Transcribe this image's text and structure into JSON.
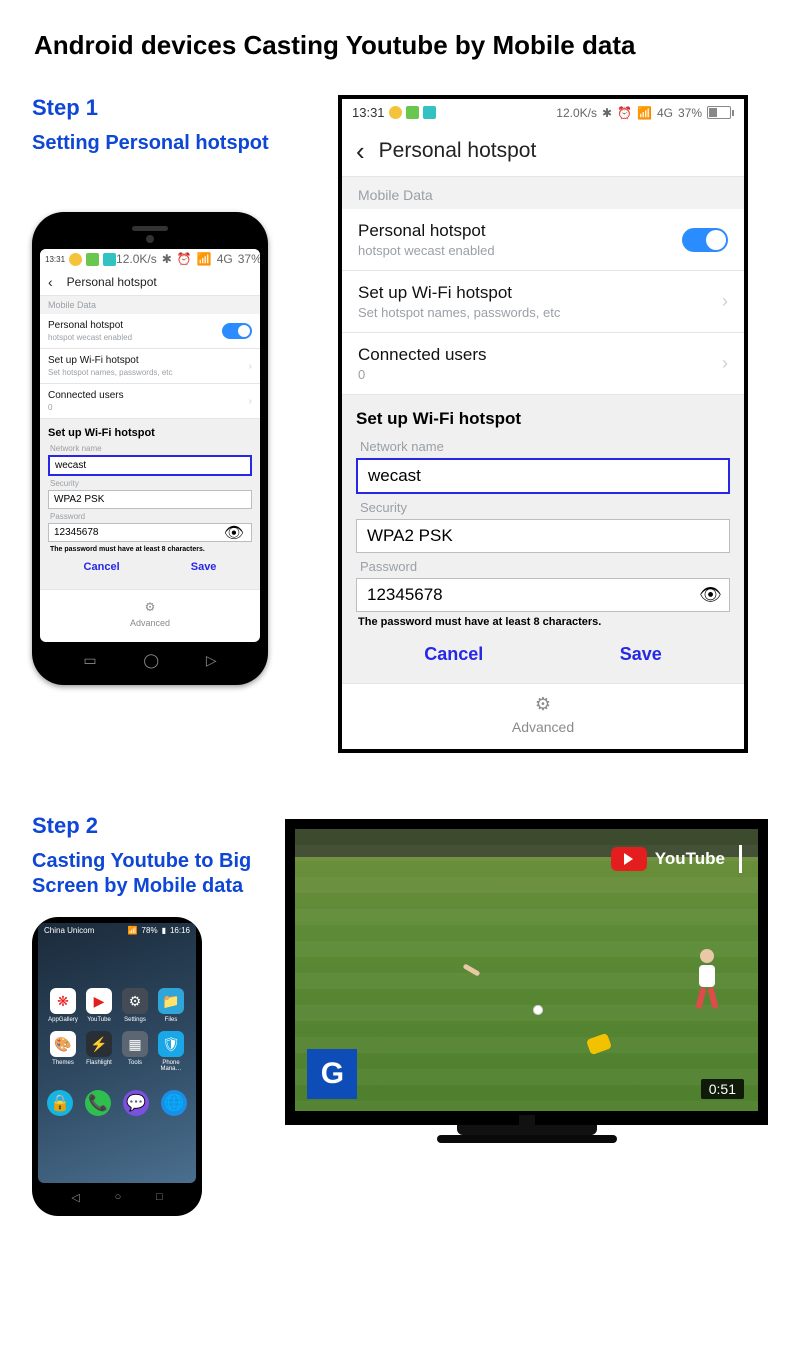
{
  "title": "Android devices Casting Youtube by Mobile data",
  "step1": {
    "label": "Step 1",
    "desc": "Setting Personal hotspot"
  },
  "status": {
    "time": "13:31",
    "speed": "12.0K/s",
    "net": "4G",
    "battery_pct": "37%"
  },
  "hotspot": {
    "screen_title": "Personal hotspot",
    "section": "Mobile Data",
    "toggle_label": "Personal hotspot",
    "toggle_sub": "hotspot wecast enabled",
    "setup_label": "Set up Wi-Fi hotspot",
    "setup_sub": "Set hotspot names, passwords, etc",
    "connected_label": "Connected users",
    "connected_count": "0",
    "form_header": "Set up Wi-Fi hotspot",
    "network_label": "Network name",
    "network_value": "wecast",
    "security_label": "Security",
    "security_value": "WPA2 PSK",
    "password_label": "Password",
    "password_value": "12345678",
    "password_hint": "The password must have at least 8 characters.",
    "cancel": "Cancel",
    "save": "Save",
    "advanced": "Advanced"
  },
  "step2": {
    "label": "Step 2",
    "desc": "Casting Youtube to Big Screen by Mobile data"
  },
  "launcher": {
    "carrier": "China Unicom",
    "battery": "78%",
    "time": "16:16",
    "apps": [
      {
        "icon": "flower",
        "name": "AppGallery",
        "bg": "#ffffff"
      },
      {
        "icon": "youtube",
        "name": "YouTube",
        "bg": "#ffffff"
      },
      {
        "icon": "gear",
        "name": "Settings",
        "bg": "#444b55"
      },
      {
        "icon": "folder",
        "name": "Files",
        "bg": "#30a5d9"
      },
      {
        "icon": "palette",
        "name": "Themes",
        "bg": "#ffffff"
      },
      {
        "icon": "flash",
        "name": "Flashlight",
        "bg": "#2a2f36"
      },
      {
        "icon": "grid",
        "name": "Tools",
        "bg": "#5c6672"
      },
      {
        "icon": "shield",
        "name": "Phone Mana…",
        "bg": "#1aa7e8"
      }
    ],
    "dock": [
      {
        "icon": "lock",
        "bg": "#16b4df"
      },
      {
        "icon": "phone",
        "bg": "#2fbf4e"
      },
      {
        "icon": "chat",
        "bg": "#7b4fe0"
      },
      {
        "icon": "globe",
        "bg": "#1a8fe8"
      }
    ]
  },
  "tv": {
    "brand": "YouTube",
    "badge": "G",
    "time": "0:51"
  }
}
